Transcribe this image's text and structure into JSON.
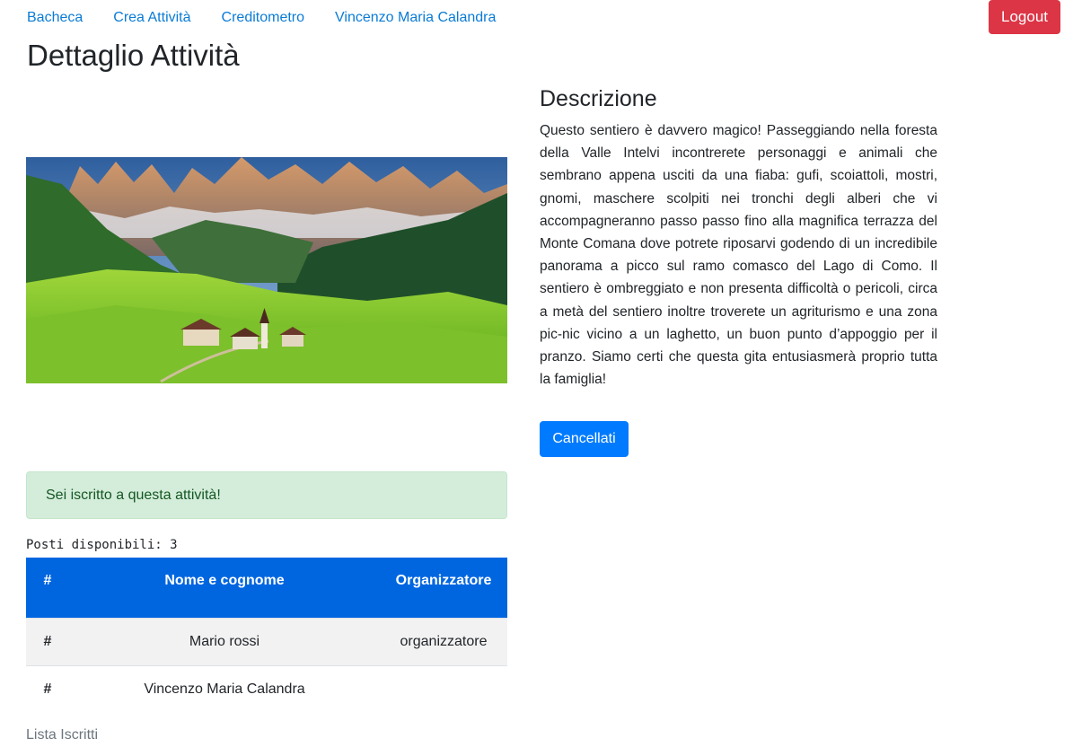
{
  "nav": {
    "links": [
      "Bacheca",
      "Crea Attività",
      "Creditometro",
      "Vincenzo Maria Calandra"
    ],
    "logout_label": "Logout"
  },
  "page_title": "Dettaglio Attività",
  "alert_text": "Sei iscritto a questa attività!",
  "seats_label": "Posti disponibili: 3",
  "table": {
    "headers": [
      "#",
      "Nome e cognome",
      "Organizzatore"
    ],
    "rows": [
      [
        "#",
        "Mario rossi",
        "organizzatore"
      ],
      [
        "#",
        "Vincenzo Maria Calandra",
        ""
      ]
    ]
  },
  "list_caption": "Lista Iscritti",
  "description": {
    "heading": "Descrizione",
    "text": "Questo sentiero è davvero magico! Passeggiando nella foresta della Valle Intelvi incontrerete personaggi e animali che sembrano appena usciti da una fiaba: gufi, scoiattoli, mostri, gnomi, maschere scolpiti nei tronchi degli alberi che vi accompagneranno passo passo fino alla magnifica terrazza del Monte Comana dove potrete riposarvi godendo di un incredibile panorama a picco sul ramo comasco del Lago di Como. Il sentiero è ombreggiato e non presenta difficoltà o pericoli, circa a metà del sentiero inoltre troverete un agriturismo e una zona pic-nic vicino a un laghetto, un buon punto d’appoggio per il pranzo. Siamo certi che questa gita entusiasmerà proprio tutta la famiglia!",
    "cancel_label": "Cancellati"
  },
  "colors": {
    "link": "#0a7bd6",
    "logout": "#dc3545",
    "primary": "#007bff",
    "table_header": "#0066e0",
    "alert_bg": "#d4edda",
    "alert_text": "#155724"
  }
}
